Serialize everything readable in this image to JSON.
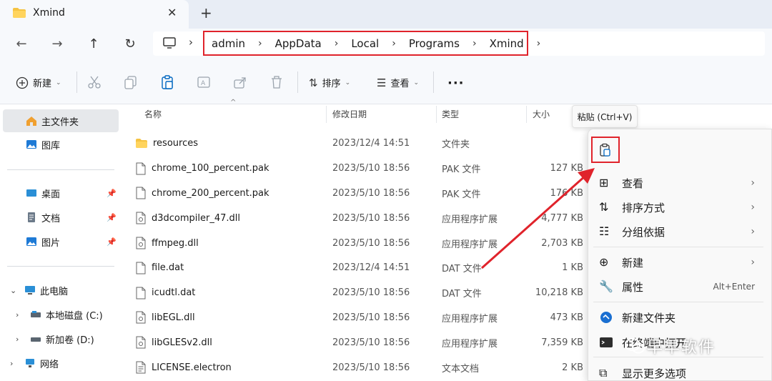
{
  "tab": {
    "title": "Xmind"
  },
  "breadcrumb": [
    "admin",
    "AppData",
    "Local",
    "Programs",
    "Xmind"
  ],
  "commands": {
    "new": "新建",
    "sort": "排序",
    "view": "查看"
  },
  "sidebar": {
    "home": "主文件夹",
    "gallery": "图库",
    "desktop": "桌面",
    "documents": "文档",
    "pictures": "图片",
    "this_pc": "此电脑",
    "local_disk": "本地磁盘 (C:)",
    "new_volume": "新加卷 (D:)",
    "network": "网络"
  },
  "columns": {
    "name": "名称",
    "modified": "修改日期",
    "type": "类型",
    "size": "大小"
  },
  "files": [
    {
      "name": "resources",
      "date": "2023/12/4 14:51",
      "type": "文件夹",
      "size": "",
      "icon": "folder-icon"
    },
    {
      "name": "chrome_100_percent.pak",
      "date": "2023/5/10 18:56",
      "type": "PAK 文件",
      "size": "127 KB",
      "icon": "file-icon"
    },
    {
      "name": "chrome_200_percent.pak",
      "date": "2023/5/10 18:56",
      "type": "PAK 文件",
      "size": "176 KB",
      "icon": "file-icon"
    },
    {
      "name": "d3dcompiler_47.dll",
      "date": "2023/5/10 18:56",
      "type": "应用程序扩展",
      "size": "4,777 KB",
      "icon": "dll-icon"
    },
    {
      "name": "ffmpeg.dll",
      "date": "2023/5/10 18:56",
      "type": "应用程序扩展",
      "size": "2,703 KB",
      "icon": "dll-icon"
    },
    {
      "name": "file.dat",
      "date": "2023/12/4 14:51",
      "type": "DAT 文件",
      "size": "1 KB",
      "icon": "file-icon"
    },
    {
      "name": "icudtl.dat",
      "date": "2023/5/10 18:56",
      "type": "DAT 文件",
      "size": "10,218 KB",
      "icon": "file-icon"
    },
    {
      "name": "libEGL.dll",
      "date": "2023/5/10 18:56",
      "type": "应用程序扩展",
      "size": "473 KB",
      "icon": "dll-icon"
    },
    {
      "name": "libGLESv2.dll",
      "date": "2023/5/10 18:56",
      "type": "应用程序扩展",
      "size": "7,359 KB",
      "icon": "dll-icon"
    },
    {
      "name": "LICENSE.electron",
      "date": "2023/5/10 18:56",
      "type": "文本文档",
      "size": "2 KB",
      "icon": "text-file-icon"
    }
  ],
  "tooltip": "粘贴 (Ctrl+V)",
  "context_menu": {
    "view": "查看",
    "sort_by": "排序方式",
    "group_by": "分组依据",
    "new": "新建",
    "properties": "属性",
    "properties_shortcut": "Alt+Enter",
    "new_folder": "新建文件夹",
    "open_terminal": "在终端中打开",
    "more_options": "显示更多选项"
  },
  "watermark": "早早软件",
  "colors": {
    "highlight": "#e0232b",
    "accent": "#0067c0"
  }
}
